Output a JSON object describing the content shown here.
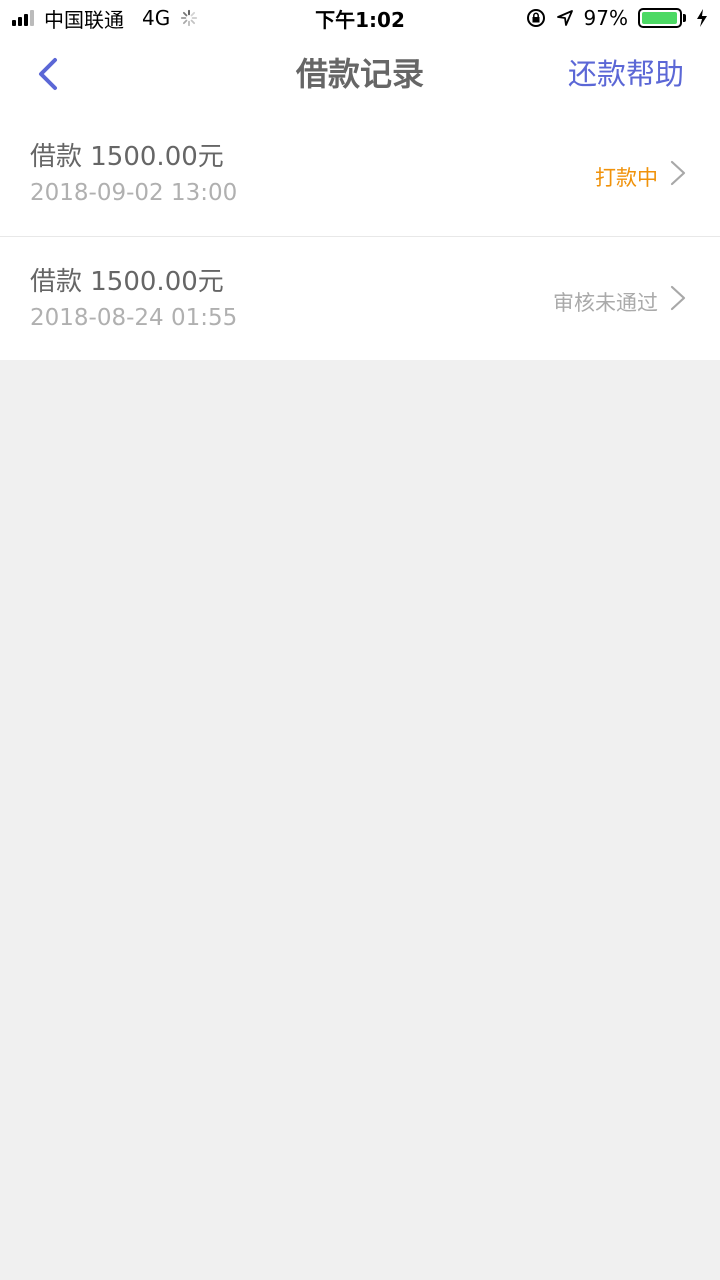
{
  "status_bar": {
    "carrier": "中国联通",
    "network": "4G",
    "time": "下午1:02",
    "battery": "97%",
    "battery_level": 0.97,
    "icons": [
      "signal-icon",
      "loading-spinner-icon",
      "rotation-lock-icon",
      "location-arrow-icon",
      "battery-icon",
      "charging-bolt-icon"
    ]
  },
  "nav": {
    "back_icon": "chevron-left-icon",
    "title": "借款记录",
    "action": "还款帮助"
  },
  "records": [
    {
      "title": "借款 1500.00元",
      "date": "2018-09-02 13:00",
      "status": "打款中",
      "status_color": "#f0920a"
    },
    {
      "title": "借款 1500.00元",
      "date": "2018-08-24 01:55",
      "status": "审核未通过",
      "status_color": "#aaaaaa"
    }
  ],
  "colors": {
    "accent": "#5b67d6",
    "background": "#f0f0f0"
  }
}
